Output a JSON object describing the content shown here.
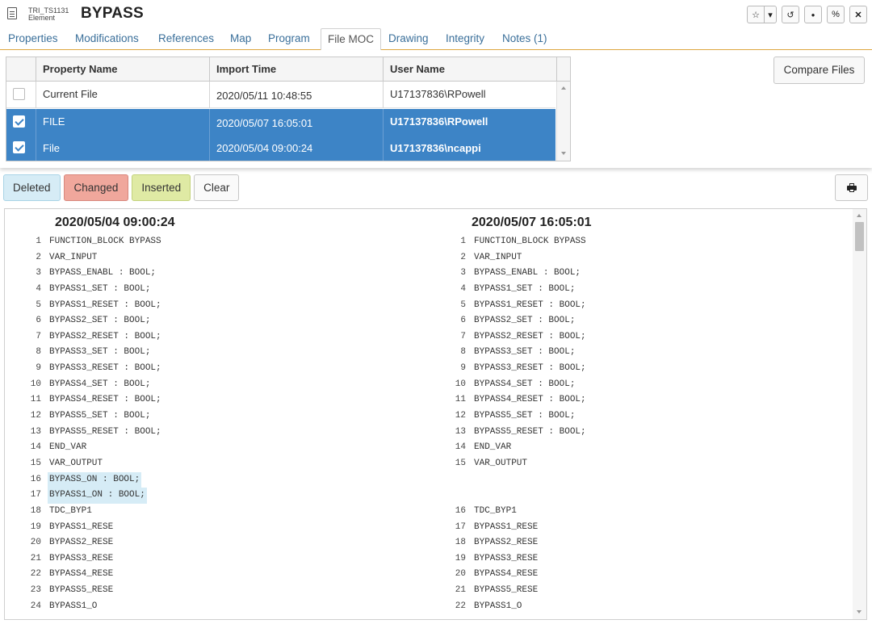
{
  "header": {
    "type_code": "TRI_TS1131",
    "type_label": "Element",
    "title": "BYPASS",
    "buttons": {
      "star": "☆",
      "dropdown": "▾",
      "history": "↺",
      "pin": "●",
      "link": "%",
      "expand": "✕"
    }
  },
  "tabs": [
    "Properties",
    "Modifications",
    "References",
    "Map",
    "Program",
    "File MOC",
    "Drawing",
    "Integrity",
    "Notes (1)"
  ],
  "active_tab": "File MOC",
  "file_table": {
    "headers": [
      "Property Name",
      "Import Time",
      "User Name"
    ],
    "rows": [
      {
        "checked": false,
        "name": "Current File",
        "time": "2020/05/11 10:48:55",
        "user": "U17137836\\RPowell"
      },
      {
        "checked": true,
        "name": "FILE",
        "time": "2020/05/07 16:05:01",
        "user": "U17137836\\RPowell"
      },
      {
        "checked": true,
        "name": "File",
        "time": "2020/05/04 09:00:24",
        "user": "U17137836\\ncappi"
      }
    ]
  },
  "compare_button": "Compare Files",
  "legend": {
    "deleted": "Deleted",
    "changed": "Changed",
    "inserted": "Inserted",
    "clear": "Clear"
  },
  "colors": {
    "deleted_bg": "#d6ecf6",
    "deleted_border": "#a8d3e6",
    "changed_bg": "#f0a79c",
    "changed_border": "#d8877c",
    "inserted_bg": "#dfeaa4",
    "inserted_border": "#c3d27c",
    "selection": "#3d84c6",
    "tab_text": "#3a6f9a",
    "tab_underline": "#e0a840"
  },
  "diff": {
    "left": {
      "title": "2020/05/04 09:00:24",
      "lines": [
        {
          "n": "1",
          "text": "FUNCTION_BLOCK BYPASS",
          "state": ""
        },
        {
          "n": "2",
          "text": "VAR_INPUT",
          "state": ""
        },
        {
          "n": "3",
          "text": "BYPASS_ENABL : BOOL;",
          "state": ""
        },
        {
          "n": "4",
          "text": "BYPASS1_SET : BOOL;",
          "state": ""
        },
        {
          "n": "5",
          "text": "BYPASS1_RESET : BOOL;",
          "state": ""
        },
        {
          "n": "6",
          "text": "BYPASS2_SET : BOOL;",
          "state": ""
        },
        {
          "n": "7",
          "text": "BYPASS2_RESET : BOOL;",
          "state": ""
        },
        {
          "n": "8",
          "text": "BYPASS3_SET : BOOL;",
          "state": ""
        },
        {
          "n": "9",
          "text": "BYPASS3_RESET : BOOL;",
          "state": ""
        },
        {
          "n": "10",
          "text": "BYPASS4_SET : BOOL;",
          "state": ""
        },
        {
          "n": "11",
          "text": "BYPASS4_RESET : BOOL;",
          "state": ""
        },
        {
          "n": "12",
          "text": "BYPASS5_SET : BOOL;",
          "state": ""
        },
        {
          "n": "13",
          "text": "BYPASS5_RESET : BOOL;",
          "state": ""
        },
        {
          "n": "14",
          "text": "END_VAR",
          "state": ""
        },
        {
          "n": "15",
          "text": "VAR_OUTPUT",
          "state": ""
        },
        {
          "n": "16",
          "text": "BYPASS_ON : BOOL;",
          "state": "deleted"
        },
        {
          "n": "17",
          "text": "BYPASS1_ON : BOOL;",
          "state": "deleted"
        },
        {
          "n": "18",
          "text": "TDC_BYP1",
          "state": ""
        },
        {
          "n": "19",
          "text": "BYPASS1_RESE",
          "state": ""
        },
        {
          "n": "20",
          "text": "BYPASS2_RESE",
          "state": ""
        },
        {
          "n": "21",
          "text": "BYPASS3_RESE",
          "state": ""
        },
        {
          "n": "22",
          "text": "BYPASS4_RESE",
          "state": ""
        },
        {
          "n": "23",
          "text": "BYPASS5_RESE",
          "state": ""
        },
        {
          "n": "24",
          "text": "BYPASS1_O",
          "state": ""
        }
      ]
    },
    "right": {
      "title": "2020/05/07 16:05:01",
      "lines": [
        {
          "n": "1",
          "text": "FUNCTION_BLOCK BYPASS",
          "state": ""
        },
        {
          "n": "2",
          "text": "VAR_INPUT",
          "state": ""
        },
        {
          "n": "3",
          "text": "BYPASS_ENABL : BOOL;",
          "state": ""
        },
        {
          "n": "4",
          "text": "BYPASS1_SET : BOOL;",
          "state": ""
        },
        {
          "n": "5",
          "text": "BYPASS1_RESET : BOOL;",
          "state": ""
        },
        {
          "n": "6",
          "text": "BYPASS2_SET : BOOL;",
          "state": ""
        },
        {
          "n": "7",
          "text": "BYPASS2_RESET : BOOL;",
          "state": ""
        },
        {
          "n": "8",
          "text": "BYPASS3_SET : BOOL;",
          "state": ""
        },
        {
          "n": "9",
          "text": "BYPASS3_RESET : BOOL;",
          "state": ""
        },
        {
          "n": "10",
          "text": "BYPASS4_SET : BOOL;",
          "state": ""
        },
        {
          "n": "11",
          "text": "BYPASS4_RESET : BOOL;",
          "state": ""
        },
        {
          "n": "12",
          "text": "BYPASS5_SET : BOOL;",
          "state": ""
        },
        {
          "n": "13",
          "text": "BYPASS5_RESET : BOOL;",
          "state": ""
        },
        {
          "n": "14",
          "text": "END_VAR",
          "state": ""
        },
        {
          "n": "15",
          "text": "VAR_OUTPUT",
          "state": ""
        },
        {
          "n": "",
          "text": "",
          "state": "gap"
        },
        {
          "n": "",
          "text": "",
          "state": "gap"
        },
        {
          "n": "16",
          "text": "TDC_BYP1",
          "state": ""
        },
        {
          "n": "17",
          "text": "BYPASS1_RESE",
          "state": ""
        },
        {
          "n": "18",
          "text": "BYPASS2_RESE",
          "state": ""
        },
        {
          "n": "19",
          "text": "BYPASS3_RESE",
          "state": ""
        },
        {
          "n": "20",
          "text": "BYPASS4_RESE",
          "state": ""
        },
        {
          "n": "21",
          "text": "BYPASS5_RESE",
          "state": ""
        },
        {
          "n": "22",
          "text": "BYPASS1_O",
          "state": ""
        }
      ]
    }
  }
}
